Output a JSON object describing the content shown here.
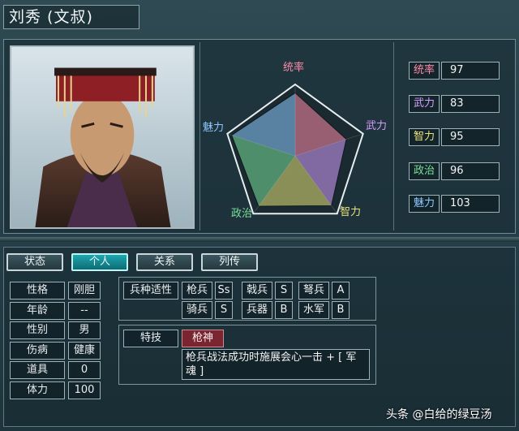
{
  "character": {
    "name": "刘秀 (文叔)"
  },
  "radar": {
    "labels": {
      "tongshuai": "统率",
      "wuli": "武力",
      "zhili": "智力",
      "zhengzhi": "政治",
      "meili": "魅力"
    },
    "values": [
      97,
      83,
      95,
      96,
      103
    ],
    "max": 110
  },
  "stats": [
    {
      "label": "统率",
      "value": "97",
      "color": "#ff8aa8"
    },
    {
      "label": "武力",
      "value": "83",
      "color": "#d79cff"
    },
    {
      "label": "智力",
      "value": "95",
      "color": "#e8e27a"
    },
    {
      "label": "政治",
      "value": "96",
      "color": "#7be09a"
    },
    {
      "label": "魅力",
      "value": "103",
      "color": "#8ec8ff"
    }
  ],
  "tabs": [
    {
      "label": "状态"
    },
    {
      "label": "个人",
      "active": true
    },
    {
      "label": "关系"
    },
    {
      "label": "列传"
    }
  ],
  "info": [
    {
      "label": "性格",
      "value": "刚胆"
    },
    {
      "label": "年龄",
      "value": "--"
    },
    {
      "label": "性别",
      "value": "男"
    },
    {
      "label": "伤病",
      "value": "健康"
    },
    {
      "label": "道具",
      "value": "0"
    },
    {
      "label": "体力",
      "value": "100"
    }
  ],
  "aptitude": {
    "title": "兵种适性",
    "items": [
      {
        "unit": "枪兵",
        "grade": "Ss"
      },
      {
        "unit": "戟兵",
        "grade": "S"
      },
      {
        "unit": "弩兵",
        "grade": "A"
      },
      {
        "unit": "骑兵",
        "grade": "S"
      },
      {
        "unit": "兵器",
        "grade": "B"
      },
      {
        "unit": "水军",
        "grade": "B"
      }
    ]
  },
  "skill": {
    "title": "特技",
    "name": "枪神",
    "description": "枪兵战法成功时施展会心一击 + [ 军魂 ]"
  },
  "watermark": "头条 @白给的绿豆汤"
}
